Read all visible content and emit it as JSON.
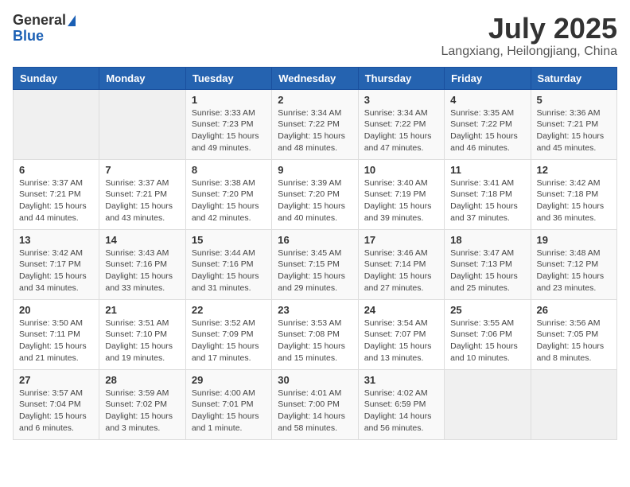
{
  "logo": {
    "general": "General",
    "blue": "Blue"
  },
  "title": "July 2025",
  "location": "Langxiang, Heilongjiang, China",
  "days_of_week": [
    "Sunday",
    "Monday",
    "Tuesday",
    "Wednesday",
    "Thursday",
    "Friday",
    "Saturday"
  ],
  "weeks": [
    [
      {
        "day": "",
        "info": ""
      },
      {
        "day": "",
        "info": ""
      },
      {
        "day": "1",
        "info": "Sunrise: 3:33 AM\nSunset: 7:23 PM\nDaylight: 15 hours\nand 49 minutes."
      },
      {
        "day": "2",
        "info": "Sunrise: 3:34 AM\nSunset: 7:22 PM\nDaylight: 15 hours\nand 48 minutes."
      },
      {
        "day": "3",
        "info": "Sunrise: 3:34 AM\nSunset: 7:22 PM\nDaylight: 15 hours\nand 47 minutes."
      },
      {
        "day": "4",
        "info": "Sunrise: 3:35 AM\nSunset: 7:22 PM\nDaylight: 15 hours\nand 46 minutes."
      },
      {
        "day": "5",
        "info": "Sunrise: 3:36 AM\nSunset: 7:21 PM\nDaylight: 15 hours\nand 45 minutes."
      }
    ],
    [
      {
        "day": "6",
        "info": "Sunrise: 3:37 AM\nSunset: 7:21 PM\nDaylight: 15 hours\nand 44 minutes."
      },
      {
        "day": "7",
        "info": "Sunrise: 3:37 AM\nSunset: 7:21 PM\nDaylight: 15 hours\nand 43 minutes."
      },
      {
        "day": "8",
        "info": "Sunrise: 3:38 AM\nSunset: 7:20 PM\nDaylight: 15 hours\nand 42 minutes."
      },
      {
        "day": "9",
        "info": "Sunrise: 3:39 AM\nSunset: 7:20 PM\nDaylight: 15 hours\nand 40 minutes."
      },
      {
        "day": "10",
        "info": "Sunrise: 3:40 AM\nSunset: 7:19 PM\nDaylight: 15 hours\nand 39 minutes."
      },
      {
        "day": "11",
        "info": "Sunrise: 3:41 AM\nSunset: 7:18 PM\nDaylight: 15 hours\nand 37 minutes."
      },
      {
        "day": "12",
        "info": "Sunrise: 3:42 AM\nSunset: 7:18 PM\nDaylight: 15 hours\nand 36 minutes."
      }
    ],
    [
      {
        "day": "13",
        "info": "Sunrise: 3:42 AM\nSunset: 7:17 PM\nDaylight: 15 hours\nand 34 minutes."
      },
      {
        "day": "14",
        "info": "Sunrise: 3:43 AM\nSunset: 7:16 PM\nDaylight: 15 hours\nand 33 minutes."
      },
      {
        "day": "15",
        "info": "Sunrise: 3:44 AM\nSunset: 7:16 PM\nDaylight: 15 hours\nand 31 minutes."
      },
      {
        "day": "16",
        "info": "Sunrise: 3:45 AM\nSunset: 7:15 PM\nDaylight: 15 hours\nand 29 minutes."
      },
      {
        "day": "17",
        "info": "Sunrise: 3:46 AM\nSunset: 7:14 PM\nDaylight: 15 hours\nand 27 minutes."
      },
      {
        "day": "18",
        "info": "Sunrise: 3:47 AM\nSunset: 7:13 PM\nDaylight: 15 hours\nand 25 minutes."
      },
      {
        "day": "19",
        "info": "Sunrise: 3:48 AM\nSunset: 7:12 PM\nDaylight: 15 hours\nand 23 minutes."
      }
    ],
    [
      {
        "day": "20",
        "info": "Sunrise: 3:50 AM\nSunset: 7:11 PM\nDaylight: 15 hours\nand 21 minutes."
      },
      {
        "day": "21",
        "info": "Sunrise: 3:51 AM\nSunset: 7:10 PM\nDaylight: 15 hours\nand 19 minutes."
      },
      {
        "day": "22",
        "info": "Sunrise: 3:52 AM\nSunset: 7:09 PM\nDaylight: 15 hours\nand 17 minutes."
      },
      {
        "day": "23",
        "info": "Sunrise: 3:53 AM\nSunset: 7:08 PM\nDaylight: 15 hours\nand 15 minutes."
      },
      {
        "day": "24",
        "info": "Sunrise: 3:54 AM\nSunset: 7:07 PM\nDaylight: 15 hours\nand 13 minutes."
      },
      {
        "day": "25",
        "info": "Sunrise: 3:55 AM\nSunset: 7:06 PM\nDaylight: 15 hours\nand 10 minutes."
      },
      {
        "day": "26",
        "info": "Sunrise: 3:56 AM\nSunset: 7:05 PM\nDaylight: 15 hours\nand 8 minutes."
      }
    ],
    [
      {
        "day": "27",
        "info": "Sunrise: 3:57 AM\nSunset: 7:04 PM\nDaylight: 15 hours\nand 6 minutes."
      },
      {
        "day": "28",
        "info": "Sunrise: 3:59 AM\nSunset: 7:02 PM\nDaylight: 15 hours\nand 3 minutes."
      },
      {
        "day": "29",
        "info": "Sunrise: 4:00 AM\nSunset: 7:01 PM\nDaylight: 15 hours\nand 1 minute."
      },
      {
        "day": "30",
        "info": "Sunrise: 4:01 AM\nSunset: 7:00 PM\nDaylight: 14 hours\nand 58 minutes."
      },
      {
        "day": "31",
        "info": "Sunrise: 4:02 AM\nSunset: 6:59 PM\nDaylight: 14 hours\nand 56 minutes."
      },
      {
        "day": "",
        "info": ""
      },
      {
        "day": "",
        "info": ""
      }
    ]
  ]
}
